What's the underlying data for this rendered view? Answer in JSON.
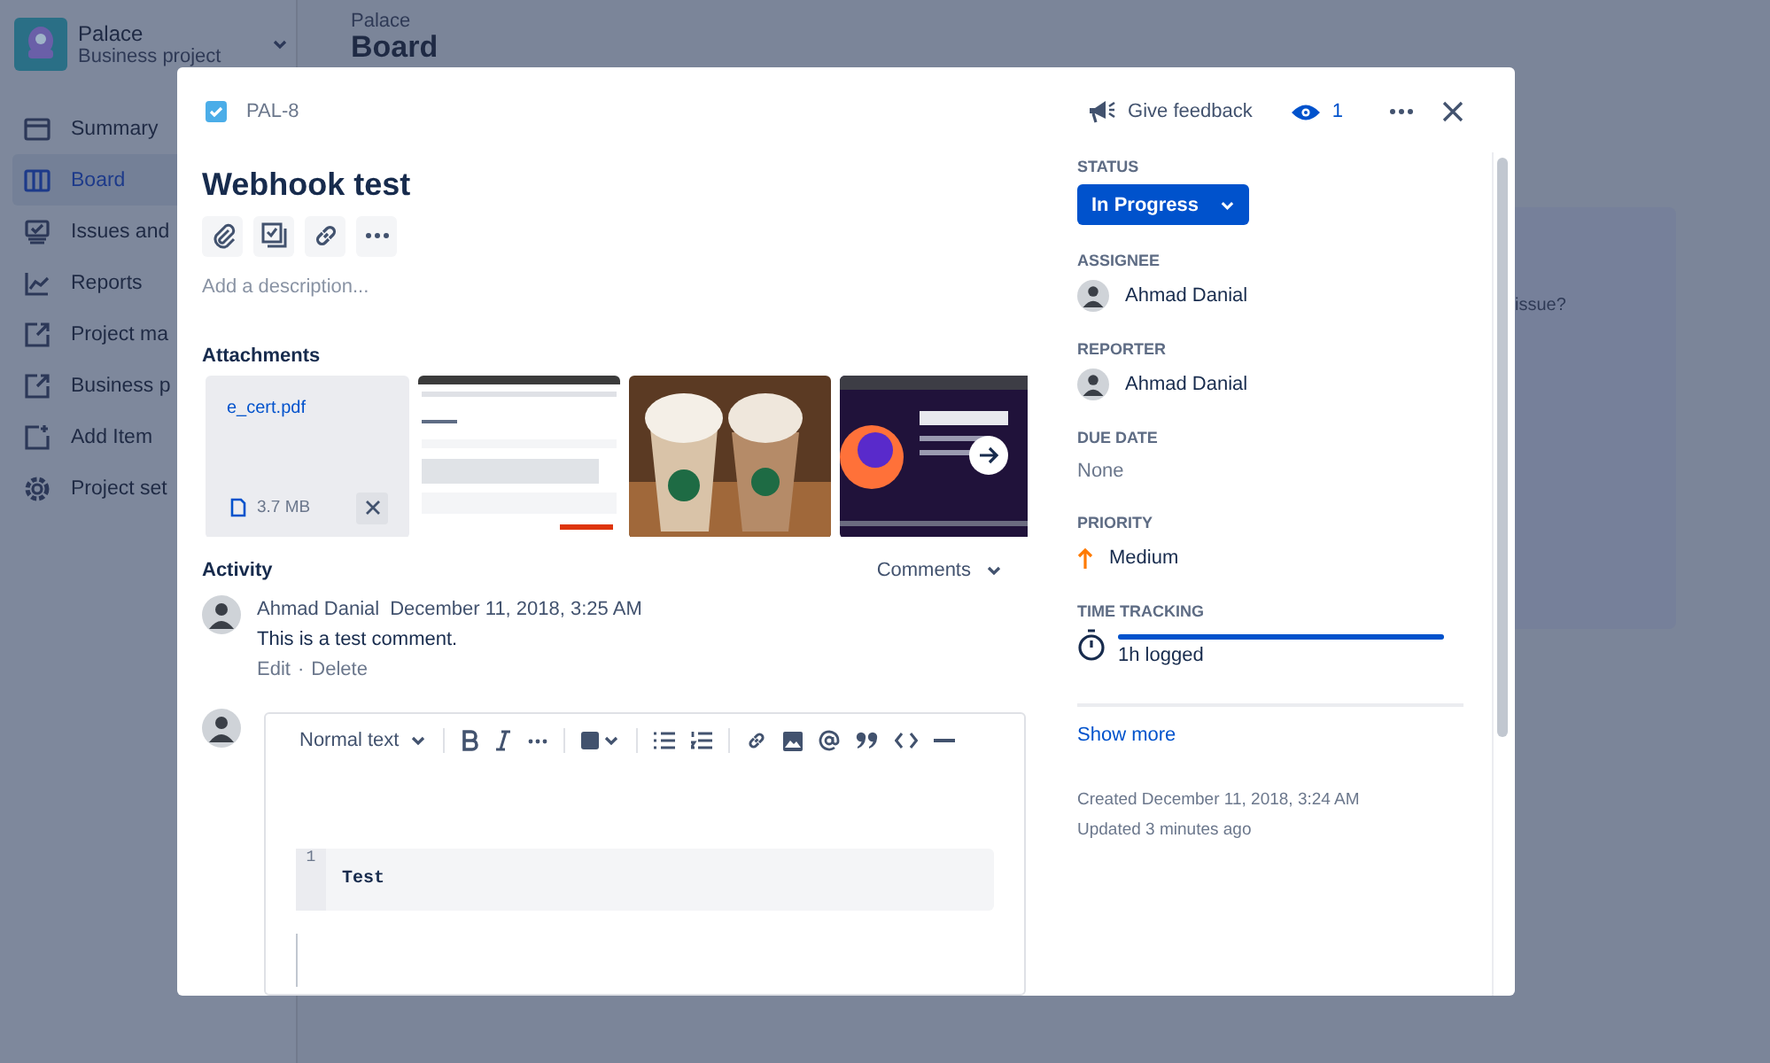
{
  "sidebar": {
    "project": {
      "name": "Palace",
      "type": "Business project"
    },
    "items": [
      {
        "label": "Summary",
        "selected": false
      },
      {
        "label": "Board",
        "selected": true
      },
      {
        "label": "Issues and",
        "selected": false
      },
      {
        "label": "Reports",
        "selected": false
      },
      {
        "label": "Project ma",
        "selected": false
      },
      {
        "label": "Business p",
        "selected": false
      },
      {
        "label": "Add Item",
        "selected": false
      },
      {
        "label": "Project set",
        "selected": false
      }
    ]
  },
  "header": {
    "breadcrumb": "Palace",
    "title": "Board"
  },
  "background_panel": {
    "text": "issue?"
  },
  "modal": {
    "issue_key": "PAL-8",
    "feedback": "Give feedback",
    "watchers": "1",
    "title": "Webhook test",
    "description_placeholder": "Add a description...",
    "attachments": {
      "heading": "Attachments",
      "items": [
        {
          "kind": "file",
          "name": "e_cert.pdf",
          "size": "3.7 MB"
        },
        {
          "kind": "picture"
        },
        {
          "kind": "picture"
        },
        {
          "kind": "picture"
        }
      ]
    },
    "activity": {
      "heading": "Activity",
      "filter": "Comments",
      "comments": [
        {
          "author": "Ahmad Danial",
          "time": "December 11, 2018, 3:25 AM",
          "text": "This is a test comment.",
          "actions": [
            "Edit",
            "Delete"
          ],
          "separator": "·"
        }
      ]
    },
    "editor": {
      "text_style": "Normal text",
      "code_lines": [
        {
          "number": "1",
          "text": "Test"
        }
      ]
    },
    "fields": [
      {
        "label": "STATUS",
        "kind": "status",
        "value": "In Progress"
      },
      {
        "label": "ASSIGNEE",
        "kind": "user",
        "value": "Ahmad Danial"
      },
      {
        "label": "REPORTER",
        "kind": "user",
        "value": "Ahmad Danial"
      },
      {
        "label": "DUE DATE",
        "kind": "empty",
        "value": "None"
      },
      {
        "label": "PRIORITY",
        "kind": "priority",
        "value": "Medium"
      },
      {
        "label": "TIME TRACKING",
        "kind": "time",
        "value": "1h logged",
        "level": 1
      }
    ],
    "show_more": "Show more",
    "created": "Created December 11, 2018, 3:24 AM",
    "updated": "Updated 3 minutes ago"
  }
}
